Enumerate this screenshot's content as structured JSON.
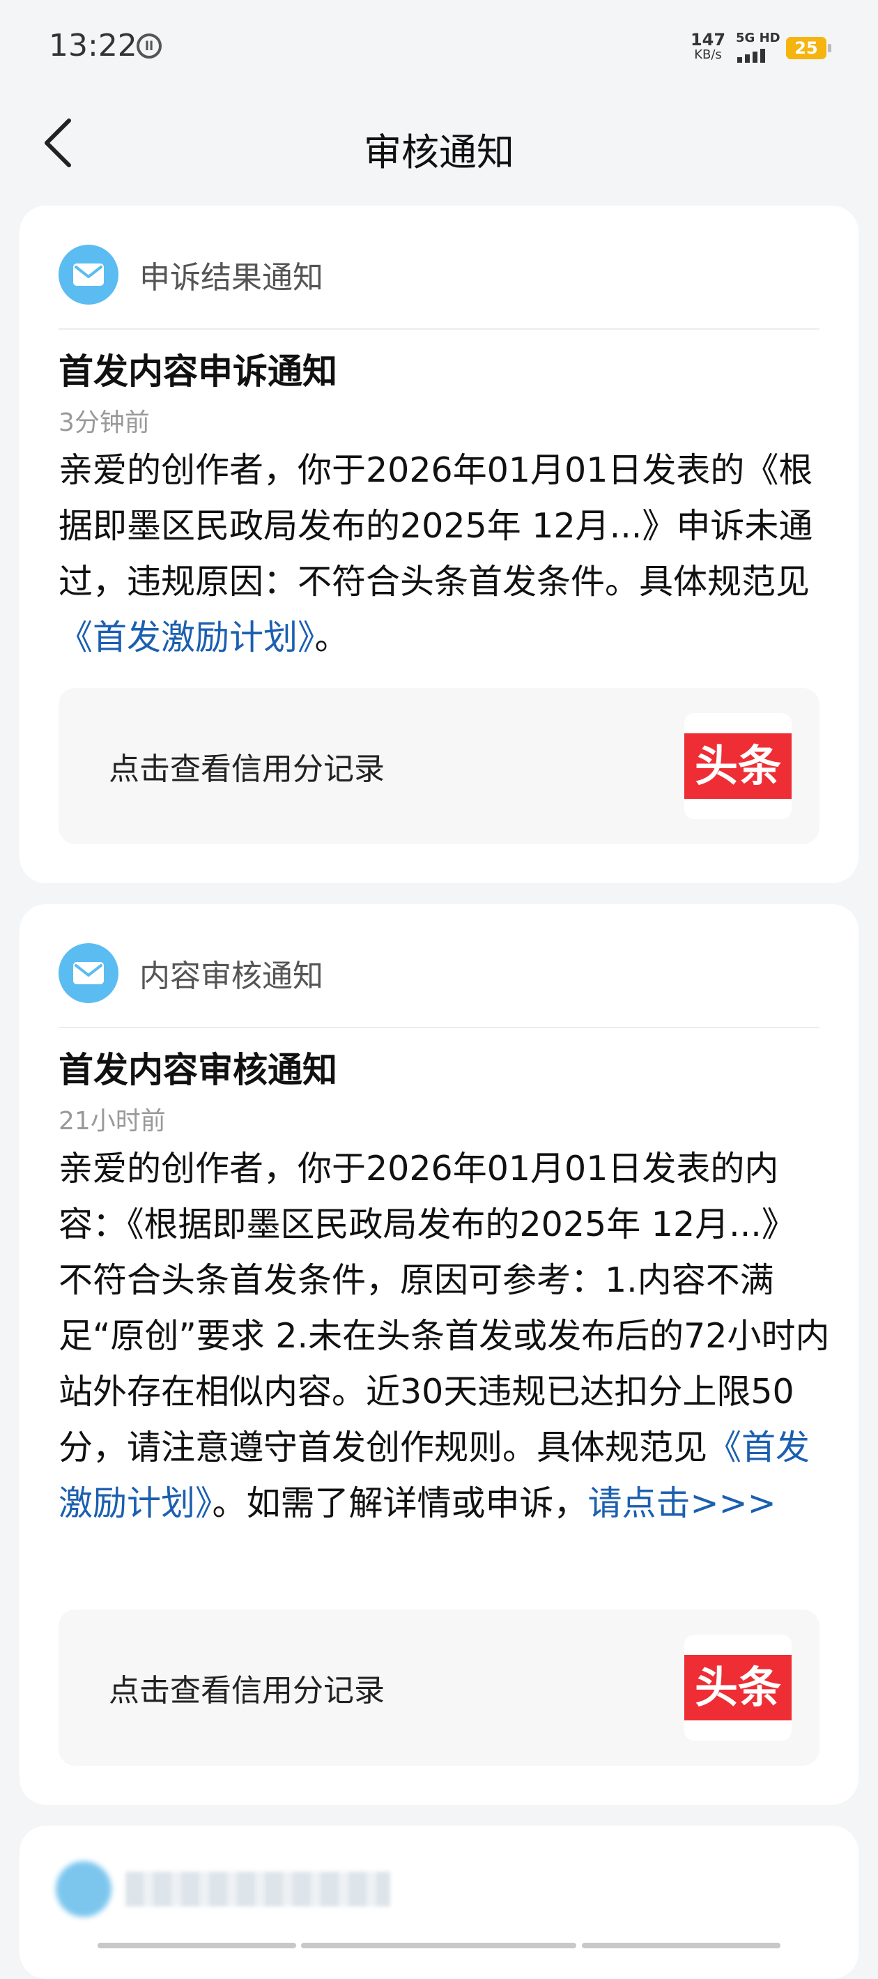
{
  "status_bar": {
    "time": "13:22",
    "app_icon_glyph": "ll",
    "net_speed_value": "147",
    "net_speed_unit": "KB/s",
    "signal_label": "5G HD",
    "battery": "25"
  },
  "nav": {
    "title": "审核通知"
  },
  "cards": [
    {
      "category": "申诉结果通知",
      "title": "首发内容申诉通知",
      "time": "3分钟前",
      "body_text": "亲爱的创作者，你于2026年01月01日发表的《根据即墨区民政局发布的2025年 12月...》申诉未通过，违规原因：不符合头条首发条件。具体规范见",
      "body_link": "《首发激励计划》",
      "body_end": "。",
      "credit_label": "点击查看信用分记录",
      "logo_text": "头条"
    },
    {
      "category": "内容审核通知",
      "title": "首发内容审核通知",
      "time": "21小时前",
      "body_text": "亲爱的创作者，你于2026年01月01日发表的内容：《根据即墨区民政局发布的2025年 12月...》 不符合头条首发条件，原因可参考：1.内容不满足“原创”要求 2.未在头条首发或发布后的72小时内站外存在相似内容。近30天违规已达扣分上限50分，请注意遵守首发创作规则。具体规范见",
      "body_link": "《首发激励计划》",
      "body_mid": "。如需了解详情或申诉，",
      "body_link2": "请点击>>>",
      "credit_label": "点击查看信用分记录",
      "logo_text": "头条"
    }
  ],
  "colors": {
    "accent_link": "#1b5fb0",
    "mail_icon": "#5bbcf2",
    "toutiao_red": "#ee2e34",
    "battery": "#f5b40f"
  }
}
